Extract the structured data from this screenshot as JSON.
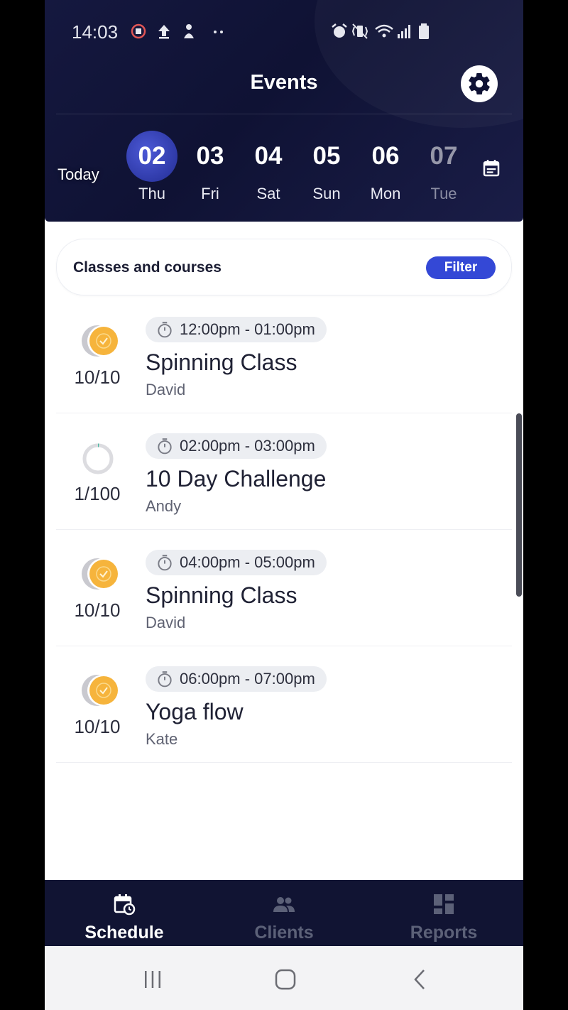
{
  "status_bar": {
    "time": "14:03",
    "icons": [
      "screen-recorder-icon",
      "upload-icon",
      "person-icon",
      "more-dots-icon",
      "alarm-icon",
      "vibrate-icon",
      "wifi-icon",
      "signal-icon",
      "battery-icon"
    ]
  },
  "header": {
    "title": "Events",
    "today_label": "Today",
    "days": [
      {
        "num": "02",
        "dow": "Thu",
        "selected": true
      },
      {
        "num": "03",
        "dow": "Fri"
      },
      {
        "num": "04",
        "dow": "Sat"
      },
      {
        "num": "05",
        "dow": "Sun"
      },
      {
        "num": "06",
        "dow": "Mon"
      },
      {
        "num": "07",
        "dow": "Tue"
      }
    ]
  },
  "filter_bar": {
    "label": "Classes and courses",
    "button": "Filter"
  },
  "events": [
    {
      "time": "12:00pm - 01:00pm",
      "title": "Spinning Class",
      "instructor": "David",
      "capacity": "10/10",
      "full": true
    },
    {
      "time": "02:00pm - 03:00pm",
      "title": "10 Day Challenge",
      "instructor": "Andy",
      "capacity": "1/100",
      "full": false
    },
    {
      "time": "04:00pm - 05:00pm",
      "title": "Spinning Class",
      "instructor": "David",
      "capacity": "10/10",
      "full": true
    },
    {
      "time": "06:00pm - 07:00pm",
      "title": "Yoga flow",
      "instructor": "Kate",
      "capacity": "10/10",
      "full": true
    }
  ],
  "bottom_nav": {
    "schedule": "Schedule",
    "clients": "Clients",
    "reports": "Reports"
  },
  "colors": {
    "header_bg": "#111433",
    "accent": "#3448d6",
    "full_badge": "#f6b43c"
  }
}
